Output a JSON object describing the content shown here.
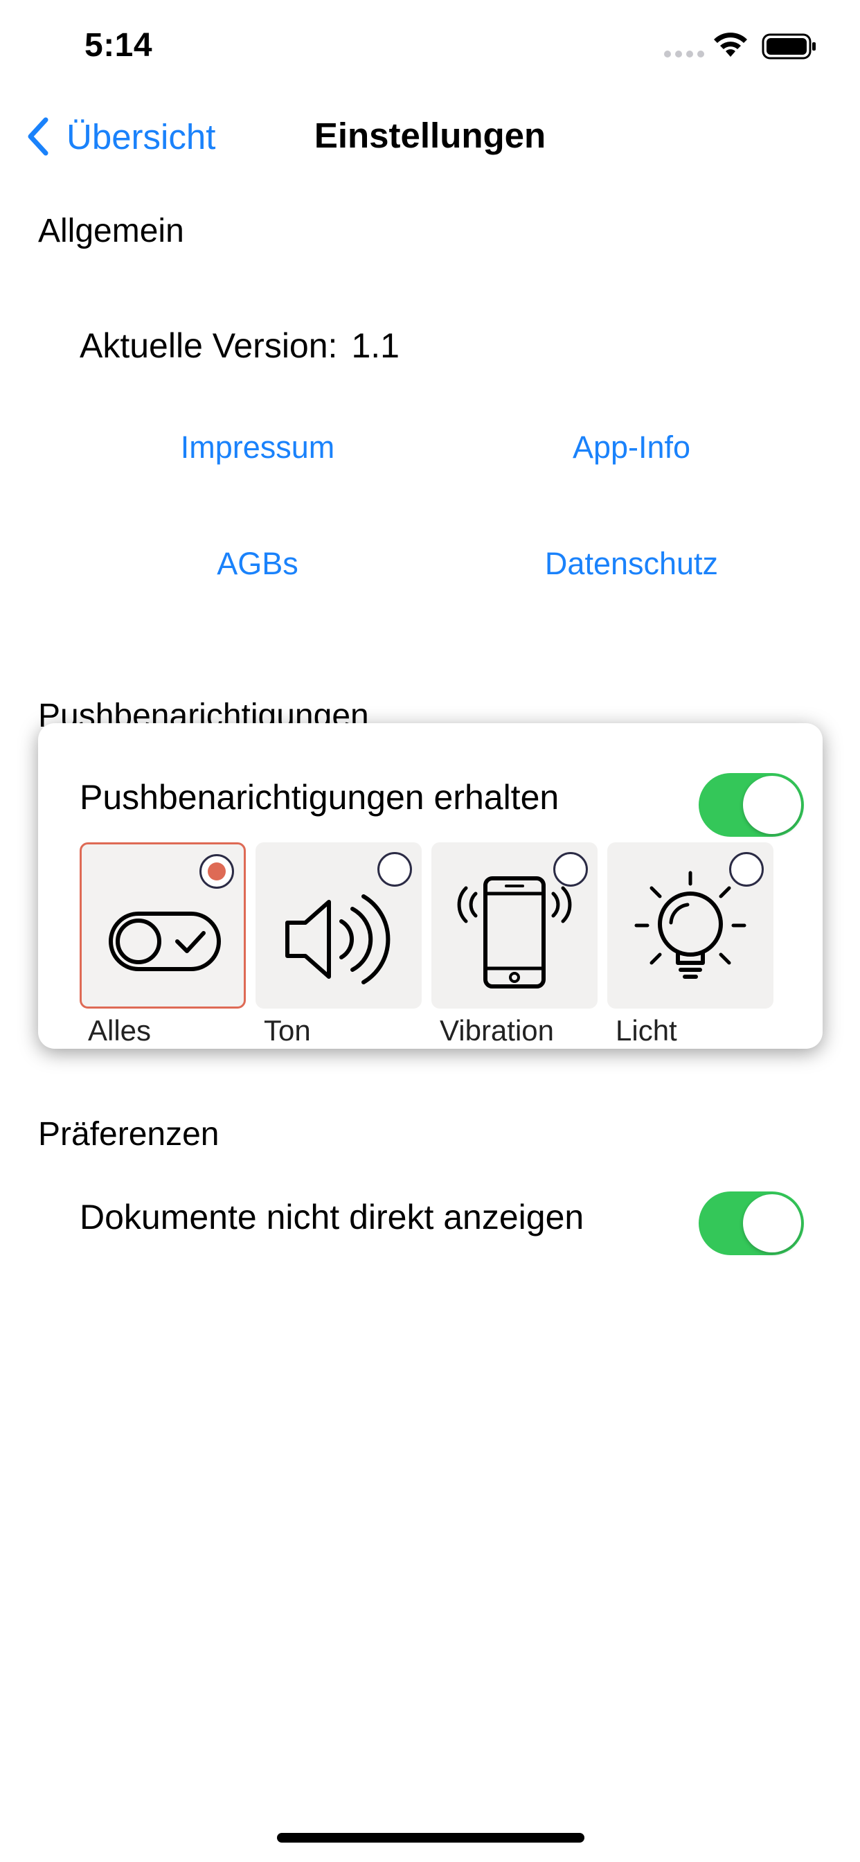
{
  "status_bar": {
    "time": "5:14",
    "icons": [
      "signal-dots-icon",
      "wifi-icon",
      "battery-icon"
    ]
  },
  "nav": {
    "back_label": "Übersicht",
    "back_icon": "chevron-left-icon",
    "title": "Einstellungen"
  },
  "general": {
    "heading": "Allgemein",
    "version_label": "Aktuelle Version:",
    "version_value": "1.1",
    "links": {
      "imprint": "Impressum",
      "app_info": "App-Info",
      "terms": "AGBs",
      "privacy": "Datenschutz"
    }
  },
  "push": {
    "heading": "Pushbenarichtigungen",
    "receive_label": "Pushbenarichtigungen erhalten",
    "receive_enabled": true,
    "options": [
      {
        "label": "Alles",
        "icon": "toggle-check-icon",
        "selected": true
      },
      {
        "label": "Ton",
        "icon": "speaker-icon",
        "selected": false
      },
      {
        "label": "Vibration",
        "icon": "phone-vibration-icon",
        "selected": false
      },
      {
        "label": "Licht",
        "icon": "light-bulb-icon",
        "selected": false
      }
    ]
  },
  "preferences": {
    "heading": "Präferenzen",
    "documents_label": "Dokumente nicht direkt anzeigen",
    "documents_enabled": true
  },
  "colors": {
    "accent_blue": "#1a82fb",
    "toggle_green": "#34c759",
    "selected_border": "#de6a55",
    "option_background": "#f2f1f0"
  }
}
